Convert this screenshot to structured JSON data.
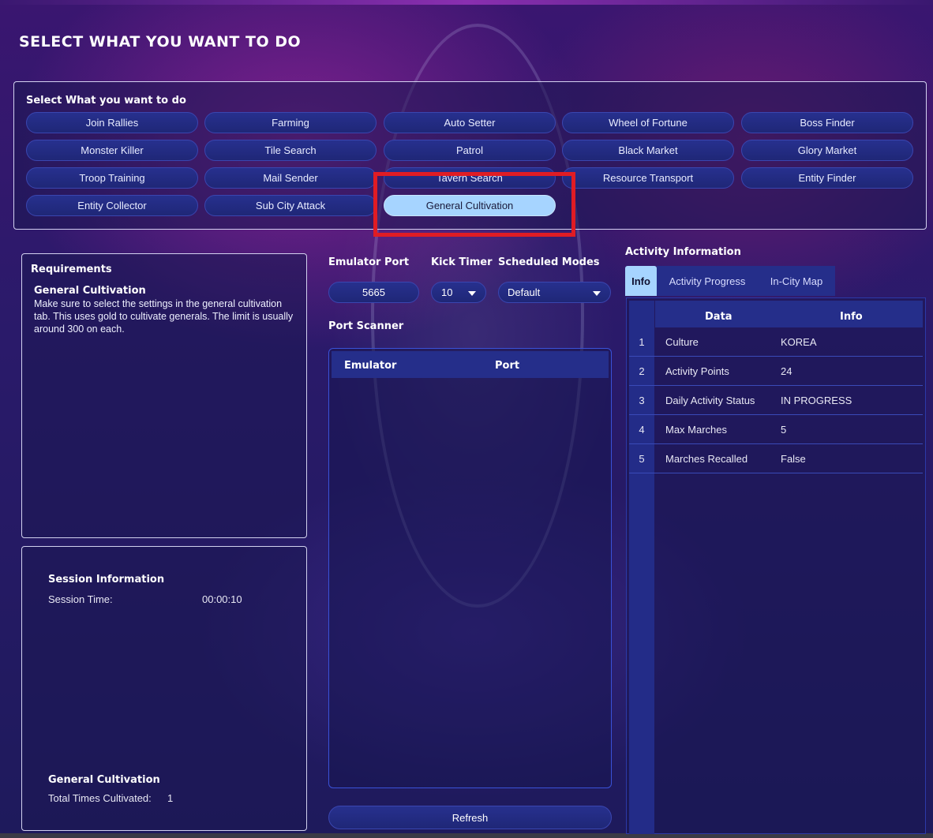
{
  "page_title": "SELECT WHAT YOU WANT TO DO",
  "select_section": {
    "label": "Select What you want to do",
    "modes": [
      "Join Rallies",
      "Farming",
      "Auto Setter",
      "Wheel of Fortune",
      "Boss Finder",
      "Monster Killer",
      "Tile Search",
      "Patrol",
      "Black Market",
      "Glory Market",
      "Troop Training",
      "Mail Sender",
      "Tavern Search",
      "Resource Transport",
      "Entity Finder",
      "Entity Collector",
      "Sub City Attack",
      "General Cultivation"
    ],
    "selected": "General Cultivation"
  },
  "requirements": {
    "title": "Requirements",
    "subtitle": "General Cultivation",
    "text": "Make sure to select the settings in the general cultivation tab. This uses gold to cultivate generals. The limit is usually around 300 on each."
  },
  "session": {
    "title": "Session Information",
    "time_label": "Session Time:",
    "time_value": "00:00:10",
    "cultivation_title": "General Cultivation",
    "cultivated_label": "Total Times Cultivated:",
    "cultivated_value": "1"
  },
  "controls": {
    "emulator_port_label": "Emulator Port",
    "emulator_port_value": "5665",
    "kick_timer_label": "Kick Timer",
    "kick_timer_value": "10",
    "scheduled_modes_label": "Scheduled Modes",
    "scheduled_modes_value": "Default"
  },
  "port_scanner": {
    "label": "Port Scanner",
    "columns": [
      "Emulator",
      "Port"
    ],
    "refresh_label": "Refresh"
  },
  "activity": {
    "title": "Activity Information",
    "tabs": [
      "Info",
      "Activity Progress",
      "In-City Map"
    ],
    "active_tab": "Info",
    "columns": [
      "Data",
      "Info"
    ],
    "rows": [
      {
        "idx": "1",
        "data": "Culture",
        "info": "KOREA"
      },
      {
        "idx": "2",
        "data": "Activity Points",
        "info": "24"
      },
      {
        "idx": "3",
        "data": "Daily Activity Status",
        "info": "IN PROGRESS"
      },
      {
        "idx": "4",
        "data": "Max Marches",
        "info": "5"
      },
      {
        "idx": "5",
        "data": "Marches Recalled",
        "info": "False"
      }
    ]
  },
  "colors": {
    "accent": "#a6d4ff",
    "button": "#27308e",
    "highlight": "#e01c24"
  }
}
